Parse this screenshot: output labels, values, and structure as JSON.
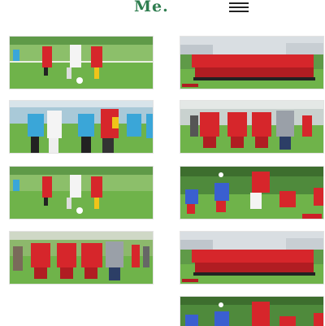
{
  "header": {
    "logo_text": "Me.",
    "menu_icon": "hamburger-icon"
  },
  "colors": {
    "brand": "#2e7d4f",
    "grass": "#6fb34a",
    "team_red": "#d6262b",
    "team_white": "#f4f4f4",
    "referee_blue": "#3aa6d8"
  },
  "gallery": {
    "photos": [
      {
        "scene": "match-action"
      },
      {
        "scene": "team-photo"
      },
      {
        "scene": "referee-dispute"
      },
      {
        "scene": "players-posing"
      },
      {
        "scene": "match-action"
      },
      {
        "scene": "header-duel"
      },
      {
        "scene": "players-posing"
      },
      {
        "scene": "team-photo"
      },
      {
        "scene": "header-duel"
      }
    ]
  }
}
